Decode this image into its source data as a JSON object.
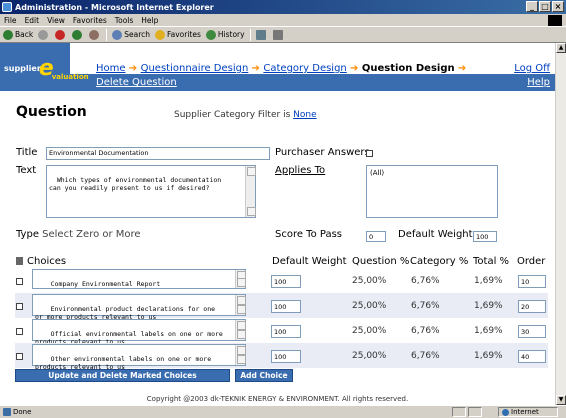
{
  "window": {
    "title": "Administration - Microsoft Internet Explorer",
    "menu": [
      "File",
      "Edit",
      "View",
      "Favorites",
      "Tools",
      "Help"
    ],
    "toolbar": {
      "back": "Back",
      "search": "Search",
      "favorites": "Favorites",
      "history": "History"
    }
  },
  "logo": {
    "pre": "supplier",
    "letter": "e",
    "post": "valuation"
  },
  "nav": {
    "home": "Home",
    "qdesign": "Questionnaire Design",
    "cdesign": "Category Design",
    "current": "Question Design",
    "logoff": "Log Off",
    "delete": "Delete Question",
    "help": "Help"
  },
  "page": {
    "title": "Question",
    "filter_label": "Supplier Category Filter is",
    "filter_value": "None"
  },
  "form": {
    "title_label": "Title",
    "title_value": "Environmental Documentation",
    "purchaser_label": "Purchaser Answers",
    "text_label": "Text",
    "text_value": "Which types of environmental documentation\ncan you readily present to us if desired?",
    "applies_to": "Applies To",
    "applies_option": "(All)",
    "type_label": "Type",
    "type_value": "Select Zero or More",
    "score_label": "Score To Pass",
    "score_value": "0",
    "weight_label": "Default Weight",
    "weight_value": "100"
  },
  "table": {
    "headers": {
      "choices": "Choices",
      "default_weight": "Default Weight",
      "question_pct": "Question %",
      "category_pct": "Category %",
      "total_pct": "Total %",
      "order": "Order"
    },
    "rows": [
      {
        "text": "Company Environmental Report",
        "weight": "100",
        "question": "25,00%",
        "category": "6,76%",
        "total": "1,69%",
        "order": "10"
      },
      {
        "text": "Environmental product declarations for one\nor more products relevant to us",
        "weight": "100",
        "question": "25,00%",
        "category": "6,76%",
        "total": "1,69%",
        "order": "20"
      },
      {
        "text": "Official environmental labels on one or more\nproducts relevant to us",
        "weight": "100",
        "question": "25,00%",
        "category": "6,76%",
        "total": "1,69%",
        "order": "30"
      },
      {
        "text": "Other environmental labels on one or more\nproducts relevant to us",
        "weight": "100",
        "question": "25,00%",
        "category": "6,76%",
        "total": "1,69%",
        "order": "40"
      }
    ]
  },
  "buttons": {
    "update": "Update and Delete Marked Choices",
    "add": "Add Choice"
  },
  "copyright": "Copyright @2003 dk-TEKNIK ENERGY & ENVIRONMENT. All rights reserved.",
  "status": {
    "left": "Done",
    "zone": "Internet"
  }
}
